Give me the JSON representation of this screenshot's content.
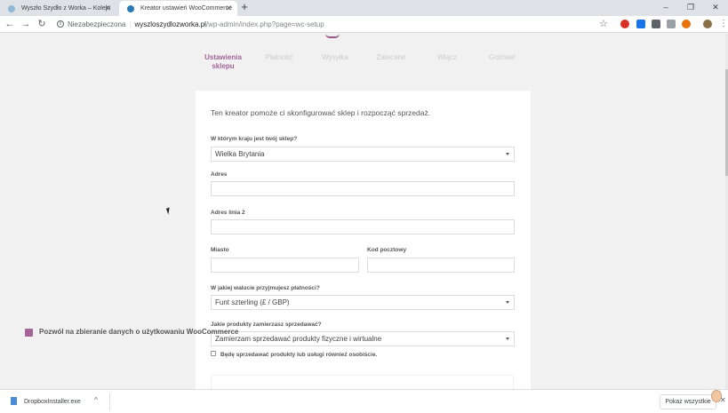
{
  "browser": {
    "tabs": [
      {
        "title": "Wyszło Szydło z Worka – Kolejn",
        "active": false
      },
      {
        "title": "Kreator ustawień WooCommerce",
        "active": true
      }
    ],
    "new_tab": "+",
    "window_controls": {
      "minimize": "–",
      "maximize": "❐",
      "close": "✕"
    },
    "nav": {
      "back": "←",
      "forward": "→",
      "reload": "↻"
    },
    "address": {
      "security_label": "Niezabezpieczona",
      "separator": "|",
      "host": "wyszloszydlozworka.pl",
      "path": "/wp-admin/index.php?page=wc-setup"
    },
    "extension_colors": [
      "#d93025",
      "#1a73e8",
      "#5f6368",
      "#9aa0a6",
      "#e8710a",
      "#8b6f47"
    ]
  },
  "wizard": {
    "steps": [
      {
        "label": "Ustawienia sklepu",
        "active": true
      },
      {
        "label": "Płatność",
        "active": false
      },
      {
        "label": "Wysyłka",
        "active": false
      },
      {
        "label": "Zalecane",
        "active": false
      },
      {
        "label": "Włącz",
        "active": false
      },
      {
        "label": "Gotowe!",
        "active": false
      }
    ],
    "intro": "Ten kreator pomoże ci skonfigurować sklep i rozpocząć sprzedaż.",
    "country": {
      "label": "W którym kraju jest twój sklep?",
      "value": "Wielka Brytania"
    },
    "address": {
      "label": "Adres",
      "value": ""
    },
    "address2": {
      "label": "Adres linia 2",
      "value": ""
    },
    "city": {
      "label": "Miasto",
      "value": ""
    },
    "postcode": {
      "label": "Kod pocztowy",
      "value": ""
    },
    "currency": {
      "label": "W jakiej walucie przyjmujesz płatności?",
      "value": "Funt szterling (£ / GBP)"
    },
    "products": {
      "label": "Jakie produkty zamierzasz sprzedawać?",
      "value": "Zamierzam sprzedawać produkty fizyczne i wirtualne"
    },
    "in_person": {
      "label": "Będę sprzedawać produkty lub usługi również osobiście.",
      "checked": false
    },
    "tracking": {
      "label": "Pozwól na zbieranie danych o użytkowaniu WooCommerce",
      "checked": true
    }
  },
  "downloads": {
    "file": "DropboxInstaller.exe",
    "chevron": "^",
    "show_all": "Pokaż wszystkie",
    "close": "✕"
  }
}
